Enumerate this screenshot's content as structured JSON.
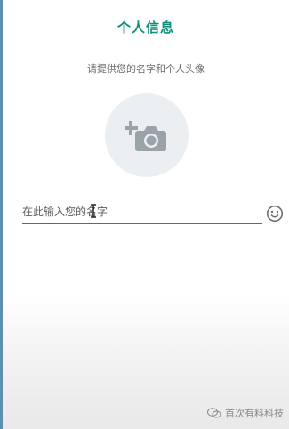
{
  "header": {
    "title": "个人信息",
    "subtitle": "请提供您的名字和个人头像"
  },
  "avatar": {
    "icon": "add-photo-camera-icon"
  },
  "name_input": {
    "placeholder": "在此输入您的名字",
    "value": ""
  },
  "emoji_button": {
    "icon": "smiley-emoji-icon"
  },
  "watermark": {
    "text": "首次有料科技",
    "icon": "wechat-icon"
  },
  "colors": {
    "accent": "#0f8f78",
    "avatar_bg": "#eceff1",
    "icon_gray": "#9aa3a8",
    "subtitle": "#6b6b6b"
  }
}
